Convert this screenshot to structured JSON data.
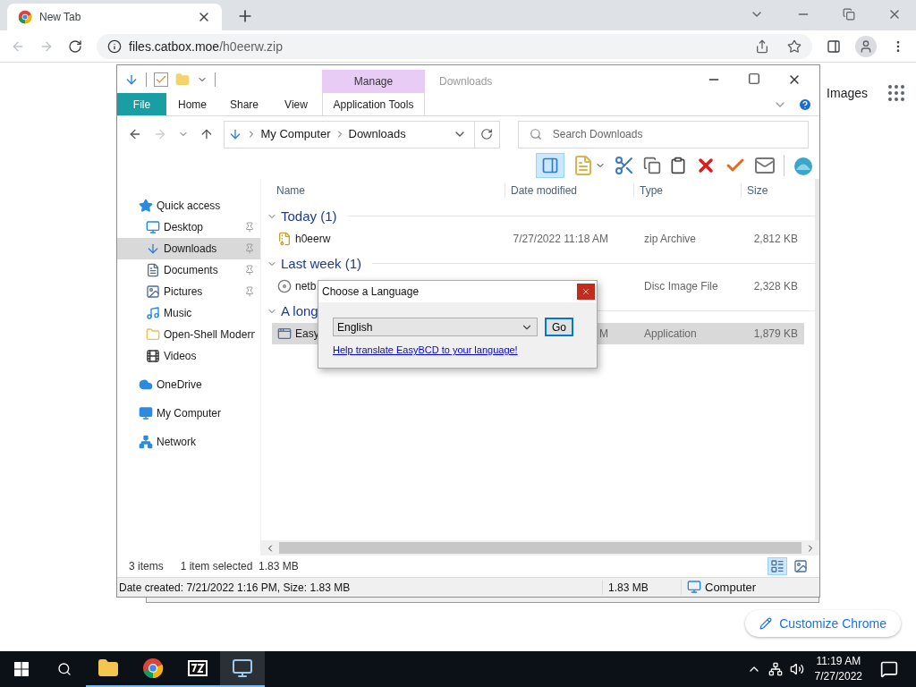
{
  "browser": {
    "tab_title": "New Tab",
    "url_host": "files.catbox.moe",
    "url_path": "/h0eerw.zip",
    "images_link": "Images",
    "customize_button": "Customize Chrome"
  },
  "explorer": {
    "window_title": "Downloads",
    "contextual_group": "Manage",
    "ribbon_tabs": [
      {
        "label": "File",
        "kind": "file"
      },
      {
        "label": "Home",
        "kind": "tab"
      },
      {
        "label": "Share",
        "kind": "tab"
      },
      {
        "label": "View",
        "kind": "tab"
      },
      {
        "label": "Application Tools",
        "kind": "contextual"
      }
    ],
    "breadcrumb": [
      "My Computer",
      "Downloads"
    ],
    "search_placeholder": "Search Downloads",
    "preview_pane": {
      "selected": true
    },
    "sidebar": [
      {
        "label": "Quick access",
        "children": [
          {
            "label": "Desktop",
            "pinned": true,
            "selected": false
          },
          {
            "label": "Downloads",
            "pinned": true,
            "selected": true
          },
          {
            "label": "Documents",
            "pinned": true,
            "selected": false
          },
          {
            "label": "Pictures",
            "pinned": true,
            "selected": false
          },
          {
            "label": "Music",
            "pinned": false,
            "selected": false
          },
          {
            "label": "Open-Shell Modern",
            "pinned": false,
            "selected": false
          },
          {
            "label": "Videos",
            "pinned": false,
            "selected": false
          }
        ]
      },
      {
        "label": "OneDrive"
      },
      {
        "label": "My Computer"
      },
      {
        "label": "Network"
      }
    ],
    "columns": [
      "Name",
      "Date modified",
      "Type",
      "Size"
    ],
    "groups": [
      {
        "label": "Today (1)",
        "files": [
          {
            "name": "h0eerw",
            "date": "7/27/2022 11:18 AM",
            "type": "zip Archive",
            "size": "2,812 KB",
            "selected": false
          }
        ]
      },
      {
        "label": "Last week (1)",
        "files": [
          {
            "name": "netb",
            "type": "Disc Image File",
            "size": "2,328 KB",
            "selected": false
          }
        ]
      },
      {
        "label": "A long",
        "files": [
          {
            "name": "Easy",
            "date": "M",
            "type": "Application",
            "size": "1,879 KB",
            "selected": true
          }
        ]
      }
    ],
    "status": {
      "items": "3 items",
      "selection": "1 item selected  1.83 MB"
    },
    "views": [
      {
        "selected": true
      },
      {
        "selected": false
      }
    ],
    "status_bar": {
      "info": "Date created: 7/21/2022 1:16 PM, Size: 1.83 MB",
      "size": "1.83 MB",
      "location": "Computer"
    }
  },
  "dialog": {
    "title": "Choose a Language",
    "language": "English",
    "go_button": "Go",
    "link": "Help translate EasyBCD to your language!"
  },
  "taskbar": {
    "apps": [
      {
        "running": true,
        "active": false
      },
      {
        "running": true,
        "active": false
      },
      {
        "running": true,
        "active": false
      },
      {
        "running": true,
        "active": true
      }
    ],
    "time": "11:19 AM",
    "date": "7/27/2022"
  }
}
